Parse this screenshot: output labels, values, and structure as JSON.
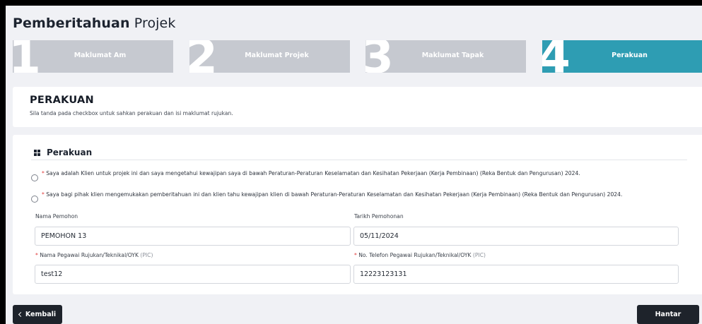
{
  "page": {
    "title_bold": "Pemberitahuan",
    "title_light": "Projek"
  },
  "steps": [
    {
      "num": "1",
      "label": "Maklumat Am",
      "active": false
    },
    {
      "num": "2",
      "label": "Maklumat Projek",
      "active": false
    },
    {
      "num": "3",
      "label": "Maklumat Tapak",
      "active": false
    },
    {
      "num": "4",
      "label": "Perakuan",
      "active": true
    }
  ],
  "header_card": {
    "title": "PERAKUAN",
    "subtitle": "Sila tanda pada checkbox untuk sahkan perakuan dan isi maklumat rujukan."
  },
  "section": {
    "title": "Perakuan",
    "icon": "grid-icon"
  },
  "declarations": [
    {
      "required_mark": "*",
      "text": "Saya adalah Klien untuk projek ini dan saya mengetahui kewajipan saya di bawah Peraturan-Peraturan Keselamatan dan Kesihatan Pekerjaan (Kerja Pembinaan) (Reka Bentuk dan Pengurusan) 2024."
    },
    {
      "required_mark": "*",
      "text": "Saya bagi pihak klien mengemukakan pemberitahuan ini dan klien tahu kewajipan klien di bawah Peraturan-Peraturan Keselamatan dan Kesihatan Pekerjaan (Kerja Pembinaan) (Reka Bentuk dan Pengurusan) 2024."
    }
  ],
  "fields": {
    "nama_pemohon": {
      "label": "Nama Pemohon",
      "value": "PEMOHON 13"
    },
    "tarikh_pemohonan": {
      "label": "Tarikh Pemohonan",
      "value": "05/11/2024"
    },
    "nama_pegawai": {
      "required_mark": "*",
      "label": "Nama Pegawai Rujukan/Teknikal/OYK",
      "suffix": "(PIC)",
      "value": "test12"
    },
    "no_telefon": {
      "required_mark": "*",
      "label": "No. Telefon Pegawai Rujukan/Teknikal/OYK",
      "suffix": "(PIC)",
      "value": "12223123131"
    }
  },
  "buttons": {
    "back": "Kembali",
    "submit": "Hantar"
  },
  "colors": {
    "step_active": "#2e9db3",
    "step_inactive": "#c6c9d0",
    "button_dark": "#1e232b",
    "required": "#e03535"
  }
}
